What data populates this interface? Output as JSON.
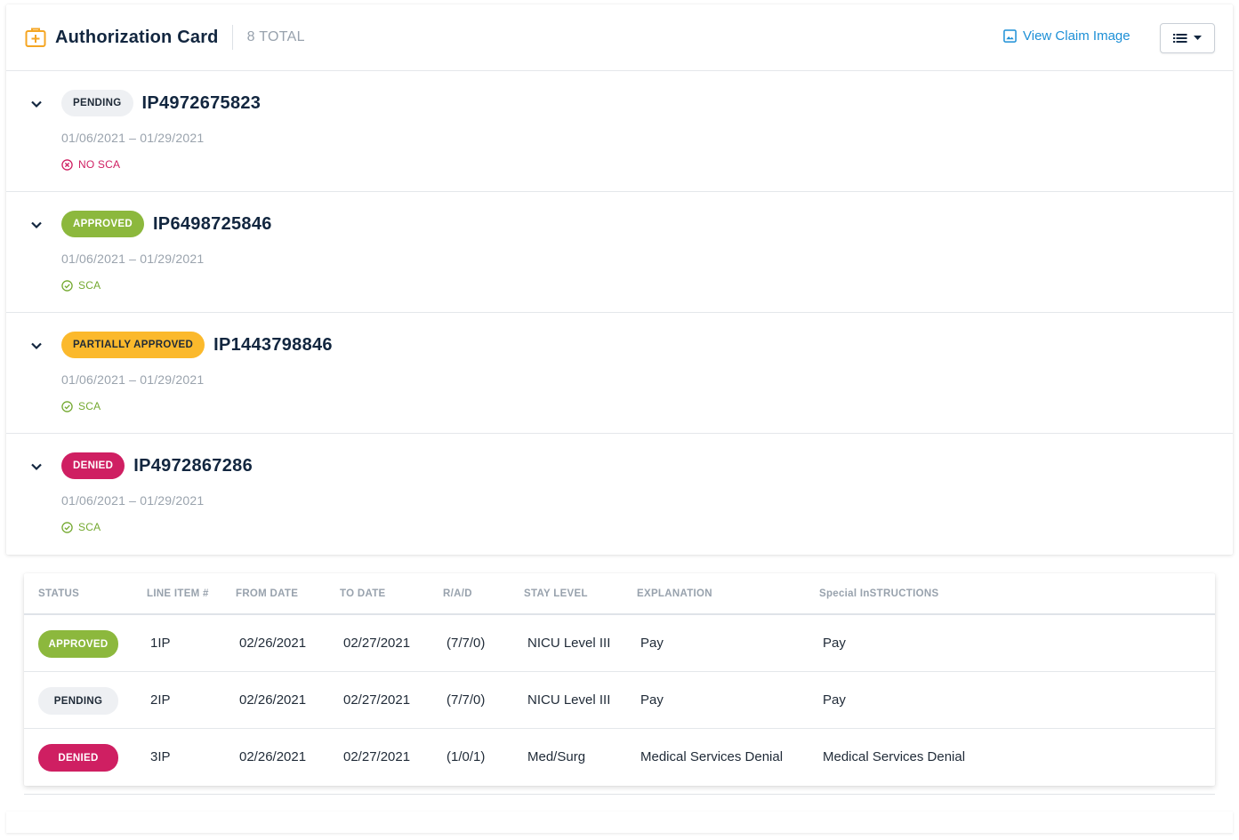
{
  "header": {
    "title": "Authorization Card",
    "total": "8 TOTAL",
    "view_claim_label": "View Claim Image"
  },
  "authorizations": [
    {
      "status": "PENDING",
      "id": "IP4972675823",
      "dates": "01/06/2021 – 01/29/2021",
      "sca": "NO SCA"
    },
    {
      "status": "APPROVED",
      "id": "IP6498725846",
      "dates": "01/06/2021 – 01/29/2021",
      "sca": "SCA"
    },
    {
      "status": "PARTIALLY APPROVED",
      "id": "IP1443798846",
      "dates": "01/06/2021 – 01/29/2021",
      "sca": "SCA"
    },
    {
      "status": "DENIED",
      "id": "IP4972867286",
      "dates": "01/06/2021 – 01/29/2021",
      "sca": "SCA"
    }
  ],
  "line_items": {
    "columns": [
      "STATUS",
      "LINE ITEM #",
      "FROM DATE",
      "TO DATE",
      "R/A/D",
      "STAY LEVEL",
      "EXPLANATION",
      "Special InSTRUCTIONS"
    ],
    "rows": [
      {
        "status": "APPROVED",
        "line_item": "1IP",
        "from": "02/26/2021",
        "to": "02/27/2021",
        "rad": "(7/7/0)",
        "stay_level": "NICU Level III",
        "explanation": "Pay",
        "instructions": "Pay"
      },
      {
        "status": "PENDING",
        "line_item": "2IP",
        "from": "02/26/2021",
        "to": "02/27/2021",
        "rad": "(7/7/0)",
        "stay_level": "NICU Level III",
        "explanation": "Pay",
        "instructions": "Pay"
      },
      {
        "status": "DENIED",
        "line_item": "3IP",
        "from": "02/26/2021",
        "to": "02/27/2021",
        "rad": "(1/0/1)",
        "stay_level": "Med/Surg",
        "explanation": "Medical Services Denial",
        "instructions": "Medical Services Denial"
      }
    ]
  },
  "colors": {
    "pending": "#eef0f3",
    "approved": "#8cb83d",
    "partially_approved": "#fbb92c",
    "denied": "#cf1f62",
    "link": "#1c8fd6",
    "icon_accent": "#f5a623"
  },
  "icons": {
    "header": "medical-kit-icon",
    "view_claim": "image-icon",
    "menu": "list-icon",
    "expand": "chevron-down-icon",
    "no_sca": "x-circle-icon",
    "sca": "check-circle-icon"
  }
}
